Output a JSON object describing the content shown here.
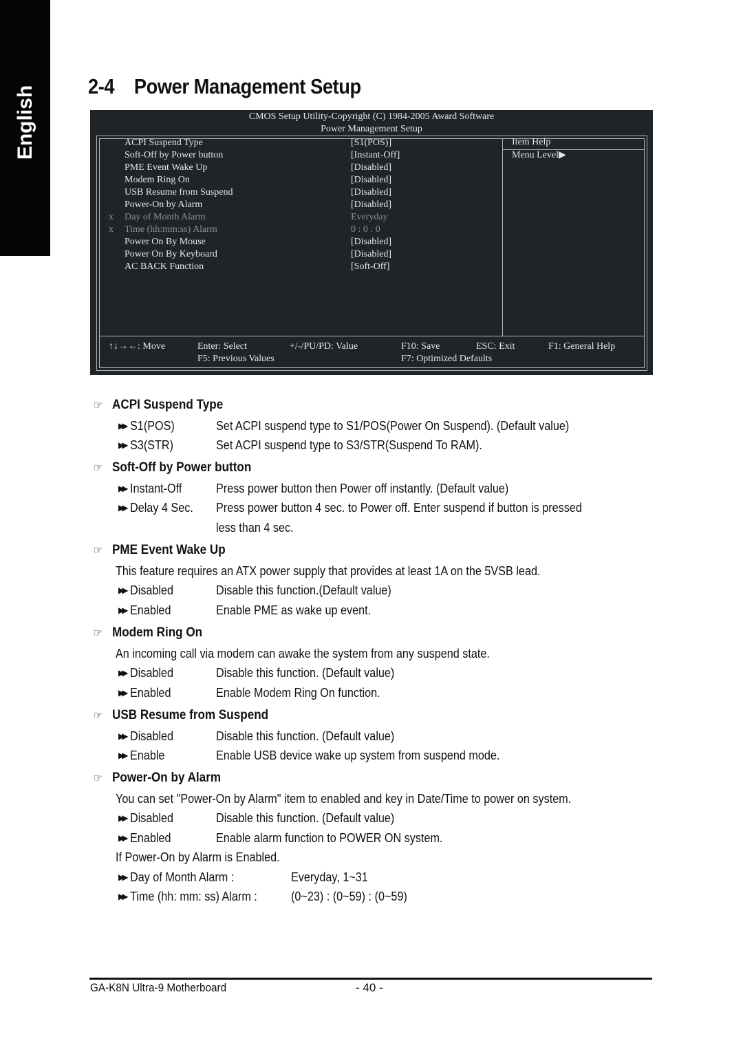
{
  "sidebar_tab": "English",
  "page": {
    "number_prefix": "2-4",
    "title": "Power Management Setup"
  },
  "bios": {
    "header_line1": "CMOS Setup Utility-Copyright (C) 1984-2005 Award Software",
    "header_line2": "Power Management Setup",
    "items": [
      {
        "marker": "",
        "label": "ACPI Suspend Type",
        "value": "[S1(POS)]",
        "disabled": false
      },
      {
        "marker": "",
        "label": "Soft-Off by Power button",
        "value": "[Instant-Off]",
        "disabled": false
      },
      {
        "marker": "",
        "label": "PME Event Wake Up",
        "value": "[Disabled]",
        "disabled": false
      },
      {
        "marker": "",
        "label": "Modem Ring On",
        "value": "[Disabled]",
        "disabled": false
      },
      {
        "marker": "",
        "label": "USB Resume from Suspend",
        "value": "[Disabled]",
        "disabled": false
      },
      {
        "marker": "",
        "label": "Power-On by Alarm",
        "value": "[Disabled]",
        "disabled": false
      },
      {
        "marker": "x",
        "label": "Day of Month Alarm",
        "value": "Everyday",
        "disabled": true
      },
      {
        "marker": "x",
        "label": "Time (hh:mm:ss) Alarm",
        "value": "0 : 0 : 0",
        "disabled": true
      },
      {
        "marker": "",
        "label": "Power On By Mouse",
        "value": "[Disabled]",
        "disabled": false
      },
      {
        "marker": "",
        "label": "Power On By Keyboard",
        "value": "[Disabled]",
        "disabled": false
      },
      {
        "marker": "",
        "label": "AC BACK Function",
        "value": "[Soft-Off]",
        "disabled": false
      }
    ],
    "help": {
      "title": "Item Help",
      "menu_level": "Menu Level▶"
    },
    "footer": {
      "move": "↑↓→←: Move",
      "select": "Enter: Select",
      "value": "+/-/PU/PD: Value",
      "save": "F10: Save",
      "exit": "ESC: Exit",
      "help": "F1: General Help",
      "previous": "F5: Previous Values",
      "optimized": "F7: Optimized Defaults"
    }
  },
  "sections": [
    {
      "title": "ACPI Suspend Type",
      "intro": "",
      "options": [
        {
          "name": "S1(POS)",
          "desc": "Set ACPI suspend type to S1/POS(Power On Suspend). (Default value)"
        },
        {
          "name": "S3(STR)",
          "desc": "Set ACPI suspend type to S3/STR(Suspend To RAM)."
        }
      ]
    },
    {
      "title": "Soft-Off by Power button",
      "intro": "",
      "options": [
        {
          "name": "Instant-Off",
          "desc": "Press power button then Power off instantly. (Default value)"
        },
        {
          "name": "Delay 4 Sec.",
          "desc": "Press power button 4 sec. to Power off. Enter suspend if button is pressed",
          "desc2": "less than 4 sec."
        }
      ]
    },
    {
      "title": "PME Event Wake Up",
      "intro": "This feature requires an ATX power supply that provides at least 1A on the 5VSB lead.",
      "options": [
        {
          "name": "Disabled",
          "desc": "Disable this function.(Default value)"
        },
        {
          "name": "Enabled",
          "desc": "Enable PME as wake up event."
        }
      ]
    },
    {
      "title": "Modem Ring On",
      "intro": "An incoming call via modem can awake the system from any suspend state.",
      "options": [
        {
          "name": "Disabled",
          "desc": "Disable this function. (Default value)"
        },
        {
          "name": "Enabled",
          "desc": "Enable Modem Ring On function."
        }
      ]
    },
    {
      "title": "USB Resume from Suspend",
      "intro": "",
      "options": [
        {
          "name": "Disabled",
          "desc": "Disable this function. (Default value)"
        },
        {
          "name": "Enable",
          "desc": "Enable USB device wake up system from suspend mode."
        }
      ]
    },
    {
      "title": "Power-On by Alarm",
      "intro": "You can set \"Power-On by Alarm\" item to enabled and key in Date/Time to power on system.",
      "options": [
        {
          "name": "Disabled",
          "desc": "Disable this function. (Default value)"
        },
        {
          "name": "Enabled",
          "desc": "Enable alarm function to POWER ON system."
        }
      ],
      "note": "If Power-On by Alarm is Enabled.",
      "sub_options": [
        {
          "name": "Day of Month Alarm :",
          "desc": "Everyday, 1~31"
        },
        {
          "name": "Time (hh: mm: ss) Alarm :",
          "desc": "(0~23) : (0~59) : (0~59)"
        }
      ]
    }
  ],
  "footer": {
    "model": "GA-K8N Ultra-9 Motherboard",
    "page_number": "- 40 -"
  }
}
